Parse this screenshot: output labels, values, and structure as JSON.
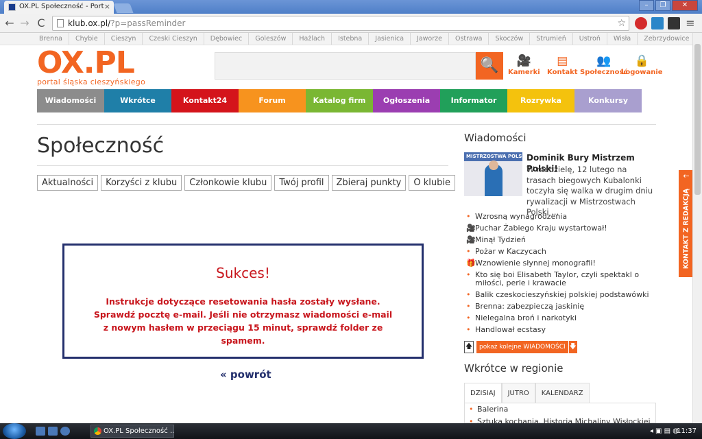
{
  "browser": {
    "tab_title": "OX.PL Społeczność - Port",
    "url_domain": "klub.ox.pl/",
    "url_path": "?p=passReminder",
    "window_user_icon": "user-icon",
    "back_label": "←",
    "forward_label": "→",
    "reload_label": "C",
    "tab_close_label": "×",
    "star_label": "☆",
    "menu_label": "≡",
    "min_label": "–",
    "max_label": "❐",
    "close_label": "✕"
  },
  "cities": [
    "Brenna",
    "Chybie",
    "Cieszyn",
    "Czeski Cieszyn",
    "Dębowiec",
    "Goleszów",
    "Hażlach",
    "Istebna",
    "Jasienica",
    "Jaworze",
    "Ostrawa",
    "Skoczów",
    "Strumień",
    "Ustroń",
    "Wisła",
    "Zebrzydowice"
  ],
  "logo": {
    "main": "OX.PL",
    "sub": "portal śląska cieszyńskiego"
  },
  "header_links": [
    {
      "label": "Kamerki",
      "icon": "camera-icon",
      "glyph": "🎥"
    },
    {
      "label": "Kontakt",
      "icon": "document-icon",
      "glyph": "▤"
    },
    {
      "label": "Społeczność",
      "icon": "people-icon",
      "glyph": "👥"
    },
    {
      "label": "Logowanie",
      "icon": "lock-icon",
      "glyph": "🔒"
    }
  ],
  "search_glyph": "🔍",
  "nav": [
    {
      "label": "Wiadomości",
      "color": "#8c8c8c"
    },
    {
      "label": "Wkrótce",
      "color": "#1f7fa8"
    },
    {
      "label": "Kontakt24",
      "color": "#d4141b"
    },
    {
      "label": "Forum",
      "color": "#f7931e"
    },
    {
      "label": "Katalog firm",
      "color": "#7ab733"
    },
    {
      "label": "Ogłoszenia",
      "color": "#9b3eb1"
    },
    {
      "label": "Informator",
      "color": "#21a05a"
    },
    {
      "label": "Rozrywka",
      "color": "#f4c20d"
    },
    {
      "label": "Konkursy",
      "color": "#a99fcf"
    }
  ],
  "page": {
    "title": "Społeczność",
    "subtabs": [
      "Aktualności",
      "Korzyści z klubu",
      "Członkowie klubu",
      "Twój profil",
      "Zbieraj punkty",
      "O klubie"
    ],
    "message_title": "Sukces!",
    "message_text": "Instrukcje dotyczące resetowania hasła zostały wysłane. Sprawdź pocztę e-mail. Jeśli nie otrzymasz wiadomości e-mail z nowym hasłem w przeciągu 15 minut, sprawdź folder ze spamem.",
    "back_link": "« powrót"
  },
  "sidebar": {
    "news_title": "Wiadomości",
    "thumb_text": "MISTRZOSTWA POLSKI",
    "featured_headline": "Dominik Bury Mistrzem Polski!",
    "featured_lead": "W niedzielę, 12 lutego na trasach biegowych Kubalonki toczyła się walka w drugim dniu rywalizacji w Mistrzostwach Polski ...",
    "news_items": [
      {
        "text": "Wzrosną wynagrodzenia",
        "icon": "bullet-icon",
        "glyph": "•"
      },
      {
        "text": "Puchar Żabiego Kraju wystartował!",
        "icon": "camera-icon",
        "glyph": "🎥"
      },
      {
        "text": "Minął Tydzień",
        "icon": "camera-icon",
        "glyph": "🎥"
      },
      {
        "text": "Pożar w Kaczycach",
        "icon": "bullet-icon",
        "glyph": "•"
      },
      {
        "text": "Wznowienie słynnej monografii!",
        "icon": "gift-icon",
        "glyph": "🎁"
      },
      {
        "text": "Kto się boi Elisabeth Taylor, czyli spektakl o miłości, perle i krawacie",
        "icon": "bullet-icon",
        "glyph": "•"
      },
      {
        "text": "Balik czeskocieszyńskiej polskiej podstawówki",
        "icon": "bullet-icon",
        "glyph": "•"
      },
      {
        "text": "Brenna: zabezpieczą jaskinię",
        "icon": "bullet-icon",
        "glyph": "•"
      },
      {
        "text": "Nielegalna broń i narkotyki",
        "icon": "bullet-icon",
        "glyph": "•"
      },
      {
        "text": "Handlował ecstasy",
        "icon": "bullet-icon",
        "glyph": "•"
      }
    ],
    "more_up_glyph": "🡅",
    "more_label": "pokaż kolejne WIADOMOŚCI",
    "more_arrow_glyph": "🡇",
    "upcoming_title": "Wkrótce w regionie",
    "day_tabs": [
      "DZISIAJ",
      "JUTRO",
      "KALENDARZ"
    ],
    "day_items": [
      "Balerina",
      "Sztuka kochania. Historia Michaliny Wisłockiej"
    ],
    "kontakt_tab": "KONTAKT Z REDAKCJĄ",
    "kontakt_arrow": "←"
  },
  "taskbar": {
    "window_title": "OX.PL Społeczność ...",
    "clock": "11:37"
  }
}
